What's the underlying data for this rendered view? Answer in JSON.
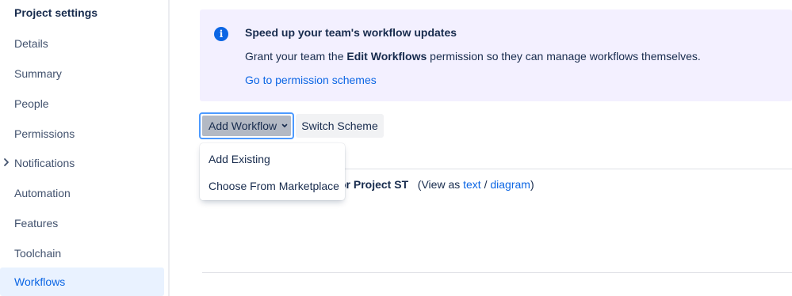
{
  "sidebar": {
    "title": "Project settings",
    "items": [
      {
        "label": "Details"
      },
      {
        "label": "Summary"
      },
      {
        "label": "People"
      },
      {
        "label": "Permissions"
      },
      {
        "label": "Notifications",
        "expandable": true
      },
      {
        "label": "Automation"
      },
      {
        "label": "Features"
      },
      {
        "label": "Toolchain"
      },
      {
        "label": "Workflows",
        "selected": true
      }
    ]
  },
  "banner": {
    "icon": "info-icon",
    "title": "Speed up your team's workflow updates",
    "text_before": "Grant your team the ",
    "text_bold": "Edit Workflows",
    "text_after": " permission so they can manage workflows themselves.",
    "link": "Go to permission schemes"
  },
  "toolbar": {
    "add_workflow_label": "Add Workflow",
    "switch_scheme_label": "Switch Scheme"
  },
  "dropdown": {
    "items": [
      {
        "label": "Add Existing"
      },
      {
        "label": "Choose From Marketplace"
      }
    ]
  },
  "workflow": {
    "title_fragment": "ow for Project ST",
    "view_as_prefix": "(View as ",
    "text_link": "text",
    "separator": " / ",
    "diagram_link": "diagram",
    "view_as_suffix": ")"
  },
  "colors": {
    "accent": "#0c66e4",
    "banner_bg": "#f3f0ff",
    "selected_bg": "#e9f2ff",
    "focus_ring": "#4c9aff"
  }
}
